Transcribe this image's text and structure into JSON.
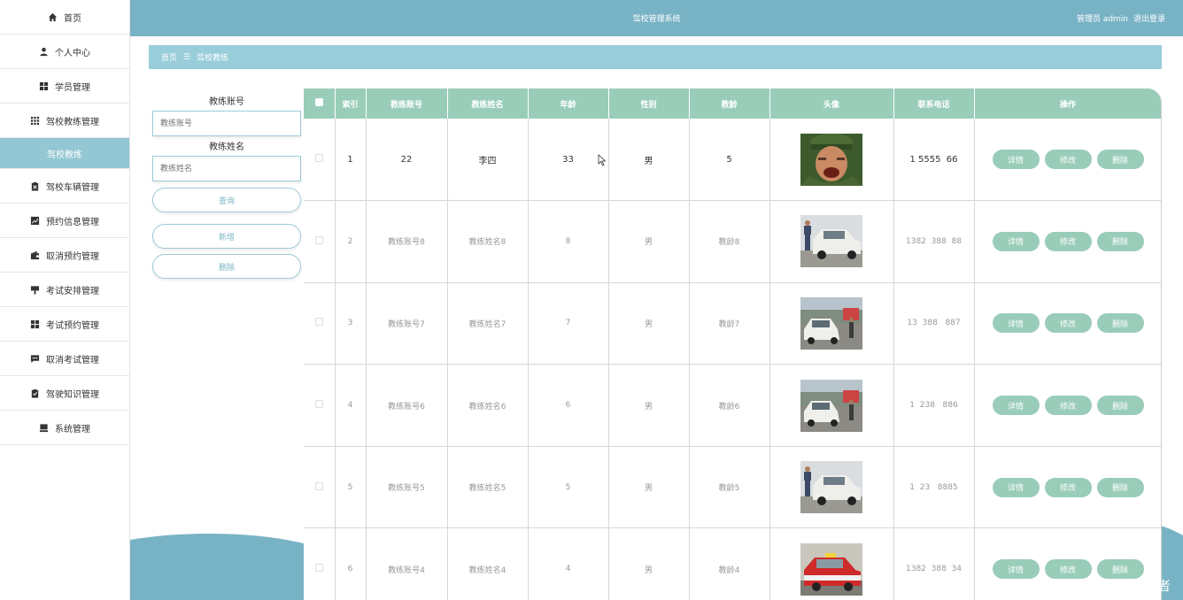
{
  "colors": {
    "header": "#78b3c5",
    "breadcrumb": "#98cdd9",
    "table_head": "#9acdb9",
    "active_menu": "#93c7d3"
  },
  "sidebar": {
    "items": [
      {
        "label": "首页",
        "icon": "home-icon"
      },
      {
        "label": "个人中心",
        "icon": "user-icon"
      },
      {
        "label": "学员管理",
        "icon": "grid-icon"
      },
      {
        "label": "驾校教练管理",
        "icon": "apps-icon"
      },
      {
        "label": "驾校教练",
        "icon": "",
        "active": true
      },
      {
        "label": "驾校车辆管理",
        "icon": "clipboard-icon"
      },
      {
        "label": "预约信息管理",
        "icon": "chart-icon"
      },
      {
        "label": "取消预约管理",
        "icon": "wallet-icon"
      },
      {
        "label": "考试安排管理",
        "icon": "sign-icon"
      },
      {
        "label": "考试预约管理",
        "icon": "grid-icon"
      },
      {
        "label": "取消考试管理",
        "icon": "chat-icon"
      },
      {
        "label": "驾驶知识管理",
        "icon": "checklist-icon"
      },
      {
        "label": "系统管理",
        "icon": "monitor-icon"
      }
    ]
  },
  "header": {
    "title": "驾校管理系统",
    "user": "管理员 admin",
    "logout": "退出登录"
  },
  "breadcrumb": {
    "home": "首页",
    "separator": "☰",
    "current": "驾校教练"
  },
  "search": {
    "account_label": "教练账号",
    "account_placeholder": "教练账号",
    "name_label": "教练姓名",
    "name_placeholder": "教练姓名",
    "query_button": "查询",
    "add_button": "新增",
    "delete_button": "删除"
  },
  "table": {
    "columns": [
      "",
      "索引",
      "教练账号",
      "教练姓名",
      "年龄",
      "性别",
      "教龄",
      "头像",
      "联系电话",
      "操作"
    ],
    "rows": [
      {
        "index": "1",
        "account": "22",
        "name": "李四",
        "age": "33",
        "gender": "男",
        "teaching_age": "5",
        "photo": "soldier-photo",
        "phone": "1 5555  66"
      },
      {
        "index": "2",
        "account": "教练账号8",
        "name": "教练姓名8",
        "age": "8",
        "gender": "男",
        "teaching_age": "教龄8",
        "photo": "car-photo",
        "phone": "1382  388  88"
      },
      {
        "index": "3",
        "account": "教练账号7",
        "name": "教练姓名7",
        "age": "7",
        "gender": "男",
        "teaching_age": "教龄7",
        "photo": "car-road-photo",
        "phone": "13  388   887"
      },
      {
        "index": "4",
        "account": "教练账号6",
        "name": "教练姓名6",
        "age": "6",
        "gender": "男",
        "teaching_age": "教龄6",
        "photo": "car-road-photo",
        "phone": "1  238   886"
      },
      {
        "index": "5",
        "account": "教练账号5",
        "name": "教练姓名5",
        "age": "5",
        "gender": "男",
        "teaching_age": "教龄5",
        "photo": "car-photo",
        "phone": "1  23   8885"
      },
      {
        "index": "6",
        "account": "教练账号4",
        "name": "教练姓名4",
        "age": "4",
        "gender": "男",
        "teaching_age": "教龄4",
        "photo": "taxi-photo",
        "phone": "1382  388  34"
      }
    ],
    "actions": {
      "detail": "详情",
      "edit": "修改",
      "delete": "删除"
    }
  },
  "watermark": "CSDN @疯狂行者"
}
